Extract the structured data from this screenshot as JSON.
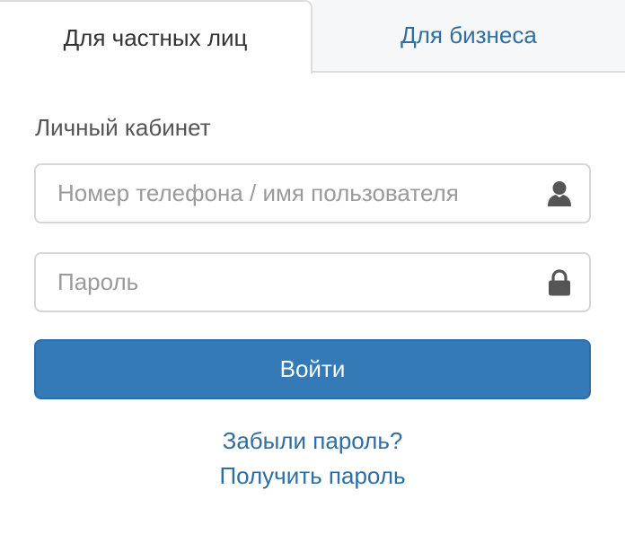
{
  "tabs": [
    {
      "label": "Для частных лиц",
      "active": true
    },
    {
      "label": "Для бизнеса",
      "active": false
    }
  ],
  "form": {
    "title": "Личный кабинет",
    "login_placeholder": "Номер телефона / имя пользователя",
    "login_value": "",
    "login_icon": "user-icon",
    "password_placeholder": "Пароль",
    "password_value": "",
    "password_icon": "lock-icon",
    "submit_label": "Войти"
  },
  "links": {
    "forgot_password": "Забыли пароль?",
    "get_password": "Получить пароль"
  },
  "colors": {
    "primary": "#337ab7",
    "link": "#2d6ea3",
    "inactive_tab_bg": "#f5f7f9",
    "icon": "#555555"
  }
}
